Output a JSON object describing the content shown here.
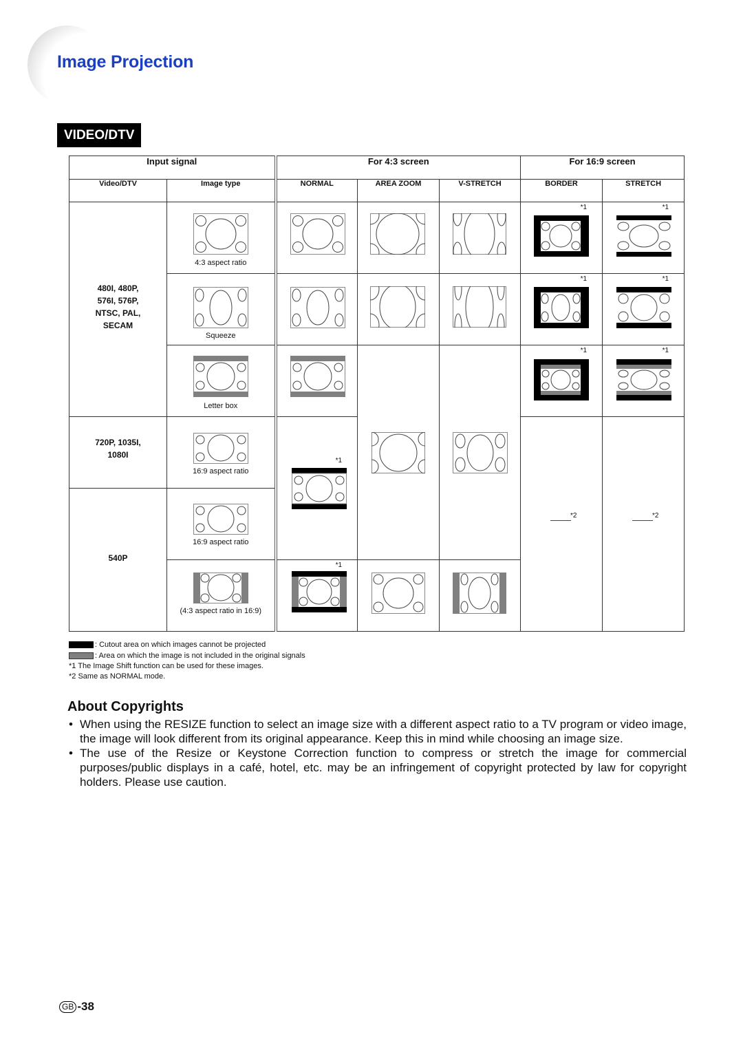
{
  "header": {
    "title": "Image Projection",
    "section_badge": "VIDEO/DTV"
  },
  "table": {
    "group_headers": {
      "input": "Input signal",
      "screen43": "For 4:3 screen",
      "screen169": "For 16:9 screen"
    },
    "columns": [
      "Video/DTV",
      "Image type",
      "NORMAL",
      "AREA ZOOM",
      "V-STRETCH",
      "BORDER",
      "STRETCH"
    ],
    "signals": {
      "sd": [
        "480I, 480P,",
        "576I, 576P,",
        "NTSC, PAL,",
        "SECAM"
      ],
      "hd": [
        "720P, 1035I,",
        "1080I"
      ],
      "p540": "540P"
    },
    "image_types": [
      "4:3 aspect ratio",
      "Squeeze",
      "Letter box",
      "16:9 aspect ratio",
      "16:9 aspect ratio",
      "(4:3 aspect ratio in 16:9)"
    ],
    "note1": "*1",
    "note2": "*2"
  },
  "legend": {
    "black": ": Cutout area on which images cannot be projected",
    "gray": ": Area on which the image is not included in the original signals",
    "fn1": "*1 The Image Shift function can be used for these images.",
    "fn2": "*2 Same as NORMAL mode."
  },
  "colors": {
    "title": "#1a3fc0",
    "cutout": "#000000",
    "not_included": "#808080"
  },
  "copyrights": {
    "heading": "About Copyrights",
    "bullets": [
      "When using the RESIZE function to select an image size with a different aspect ratio to a TV program or video image, the image will look different from its original appearance. Keep this in mind while choosing an image size.",
      "The use of the Resize or Keystone Correction function to compress or stretch the image for commercial purposes/public displays in a café, hotel, etc. may be an infringement of copyright protected by law for copyright holders. Please use caution."
    ]
  },
  "footer": {
    "region": "GB",
    "page": "-38"
  }
}
